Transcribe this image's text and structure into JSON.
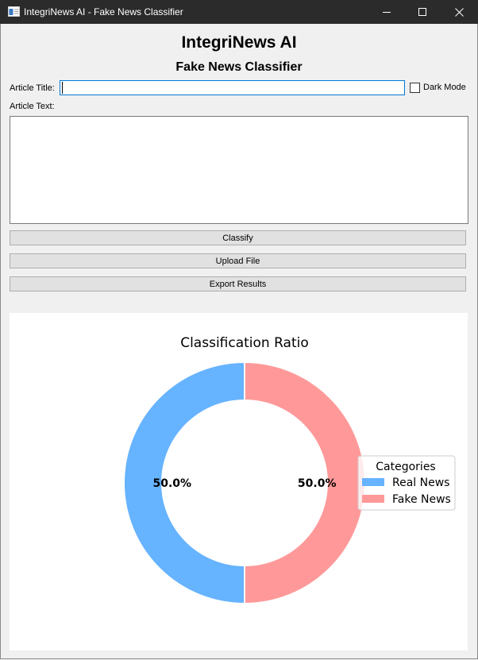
{
  "window": {
    "title": "IntegriNews AI - Fake News Classifier",
    "controls": [
      "minimize-icon",
      "maximize-icon",
      "close-icon"
    ]
  },
  "header": {
    "title": "IntegriNews AI",
    "subtitle": "Fake News Classifier"
  },
  "form": {
    "title_label": "Article Title:",
    "title_value": "",
    "dark_mode_label": "Dark Mode",
    "dark_mode_checked": false,
    "text_label": "Article Text:",
    "text_value": ""
  },
  "buttons": {
    "classify": "Classify",
    "upload": "Upload File",
    "export": "Export Results"
  },
  "colors": {
    "real": "#66b3ff",
    "fake": "#ff9999",
    "input_focus": "#0078d7"
  },
  "chart_data": {
    "type": "pie",
    "variant": "donut",
    "title": "Classification Ratio",
    "categories": [
      "Real News",
      "Fake News"
    ],
    "values": [
      50.0,
      50.0
    ],
    "labels": [
      "50.0%",
      "50.0%"
    ],
    "colors": [
      "#66b3ff",
      "#ff9999"
    ],
    "legend": {
      "title": "Categories",
      "placement": "right"
    }
  }
}
